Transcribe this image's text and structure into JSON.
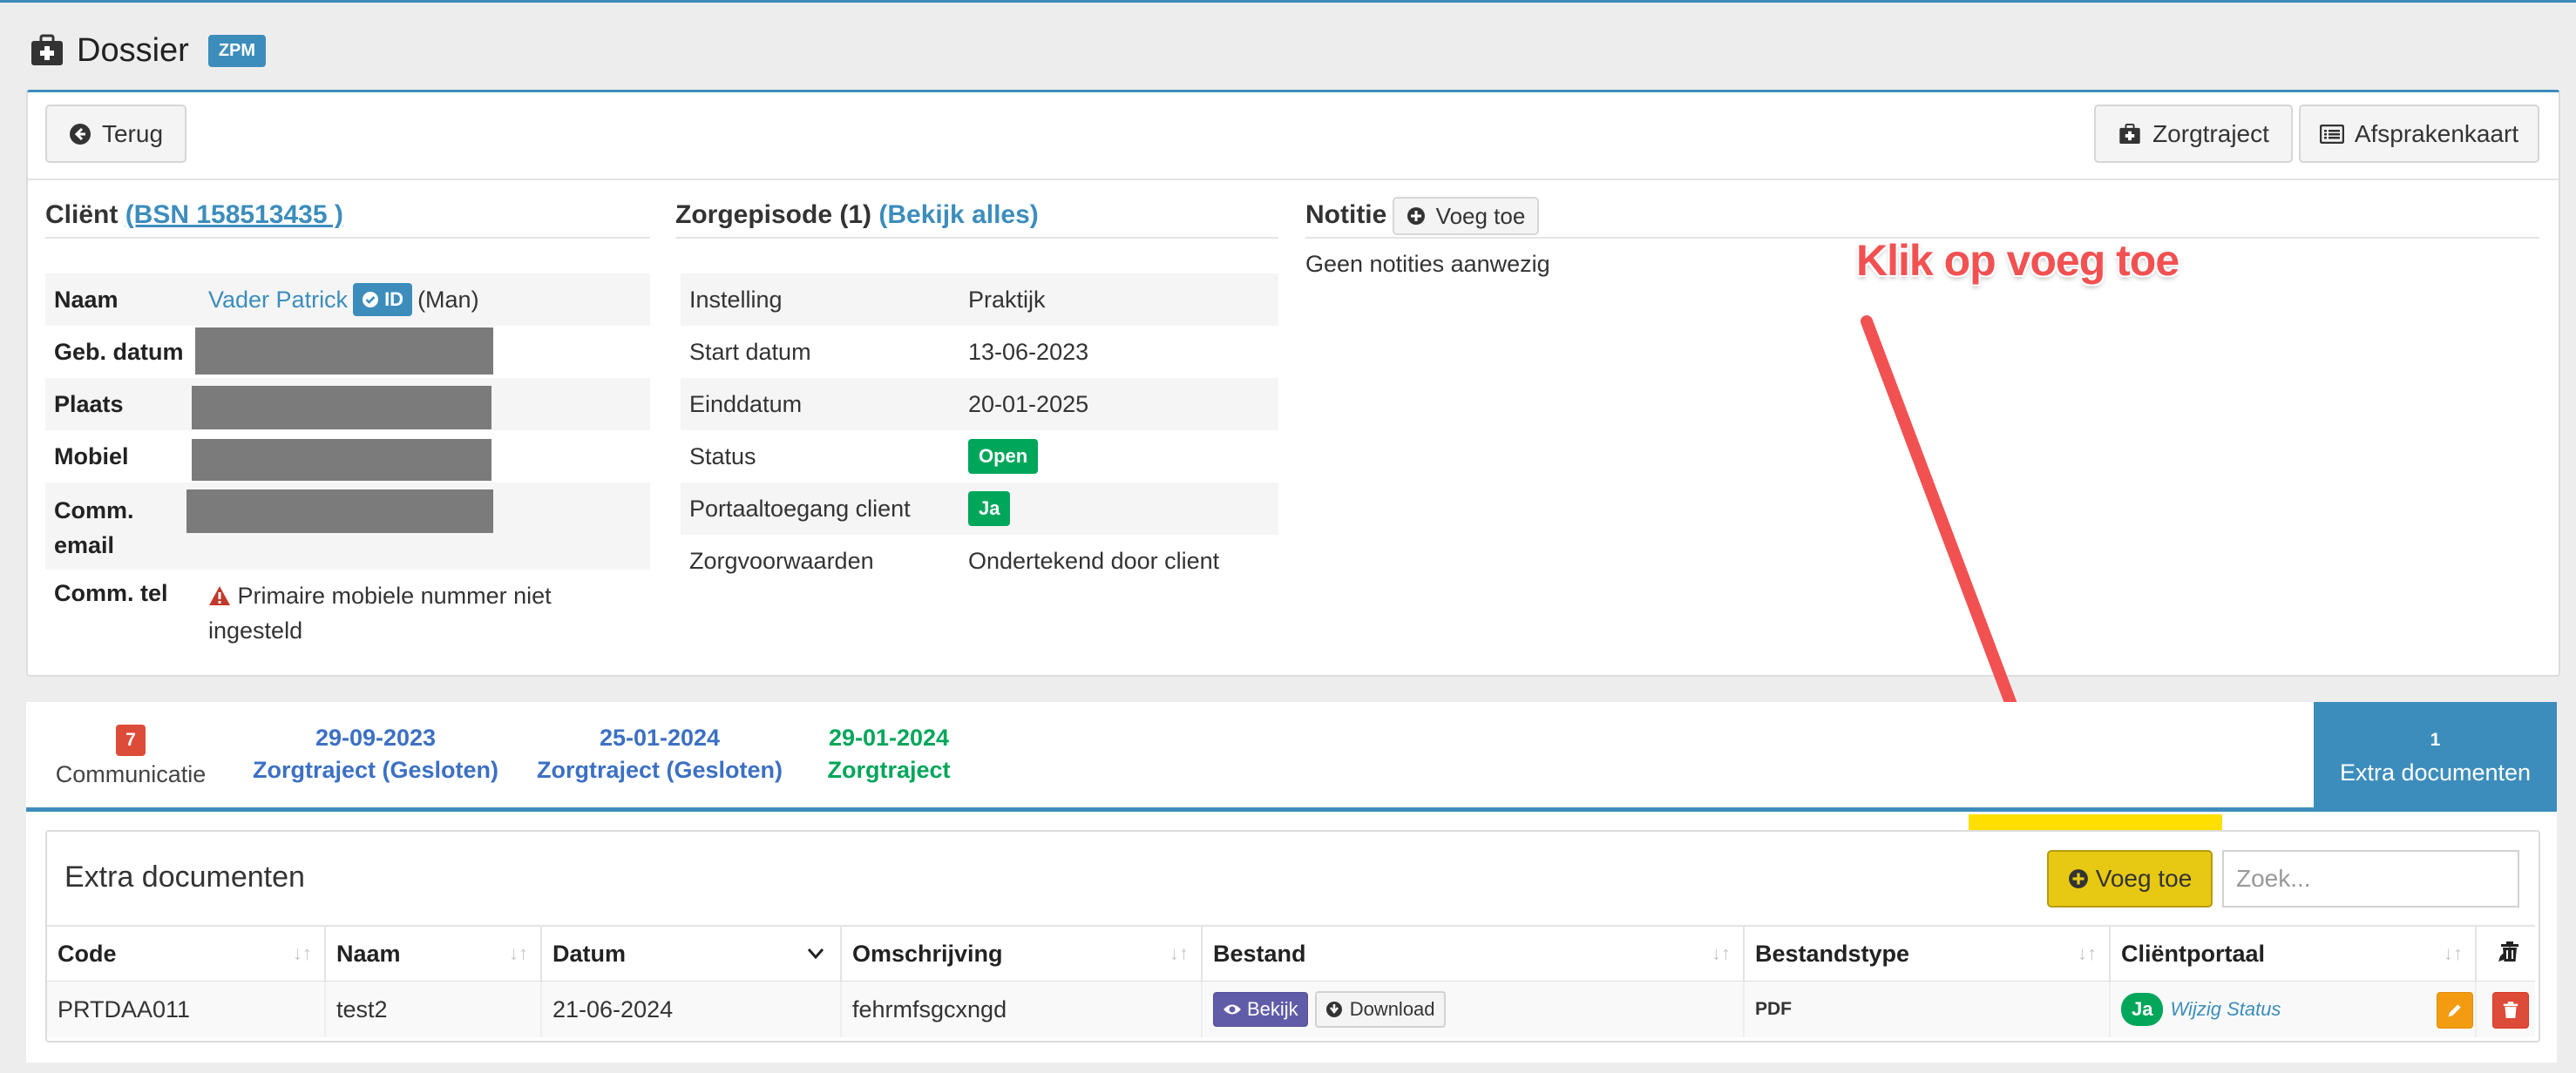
{
  "header": {
    "title": "Dossier",
    "badge": "ZPM",
    "icon": "medical-kit-icon"
  },
  "toolbar": {
    "back_label": "Terug",
    "zorgtraject_label": "Zorgtraject",
    "afsprakenkaart_label": "Afsprakenkaart"
  },
  "client": {
    "title": "Cliënt",
    "bsn_link": "(BSN 158513435 )",
    "rows": {
      "naam_label": "Naam",
      "naam_value": "Vader Patrick",
      "id_badge": "ID",
      "gender": "(Man)",
      "geb_label": "Geb. datum",
      "plaats_label": "Plaats",
      "mobiel_label": "Mobiel",
      "email_label_1": "Comm.",
      "email_label_2": "email",
      "tel_label": "Comm. tel",
      "tel_warning_1": "Primaire mobiele nummer niet",
      "tel_warning_2": "ingesteld"
    }
  },
  "episode": {
    "title": "Zorgepisode (1)",
    "link": "(Bekijk alles)",
    "rows": [
      {
        "label": "Instelling",
        "value": "Praktijk"
      },
      {
        "label": "Start datum",
        "value": "13-06-2023"
      },
      {
        "label": "Einddatum",
        "value": "20-01-2025"
      },
      {
        "label": "Status",
        "value": "Open"
      },
      {
        "label": "Portaaltoegang client",
        "value": "Ja"
      },
      {
        "label": "Zorgvoorwaarden",
        "value": "Ondertekend door client"
      }
    ]
  },
  "notes": {
    "title": "Notitie",
    "add_label": "Voeg toe",
    "empty_text": "Geen notities aanwezig"
  },
  "annotation": {
    "text": "Klik op voeg toe",
    "color": "#f25152"
  },
  "tabs": [
    {
      "badge": "7",
      "label": "Communicatie"
    },
    {
      "date": "29-09-2023",
      "label": "Zorgtraject (Gesloten)"
    },
    {
      "date": "25-01-2024",
      "label": "Zorgtraject (Gesloten)"
    },
    {
      "date": "29-01-2024",
      "label": "Zorgtraject"
    },
    {
      "count": "1",
      "label": "Extra documenten"
    }
  ],
  "documents": {
    "title": "Extra documenten",
    "add_label": "Voeg toe",
    "search_placeholder": "Zoek...",
    "columns": [
      "Code",
      "Naam",
      "Datum",
      "Omschrijving",
      "Bestand",
      "Bestandstype",
      "Cliëntportaal"
    ],
    "rows": [
      {
        "code": "PRTDAA011",
        "naam": "test2",
        "datum": "21-06-2024",
        "omschrijving": "fehrmfsgcxngd",
        "view_label": "Bekijk",
        "download_label": "Download",
        "type": "PDF",
        "portal": "Ja",
        "status_link": "Wijzig Status"
      }
    ]
  },
  "colors": {
    "primary": "#3c8dbc",
    "success": "#00a65a",
    "danger": "#dd4b39",
    "warning": "#f39c12",
    "highlight": "#ffdf00"
  }
}
